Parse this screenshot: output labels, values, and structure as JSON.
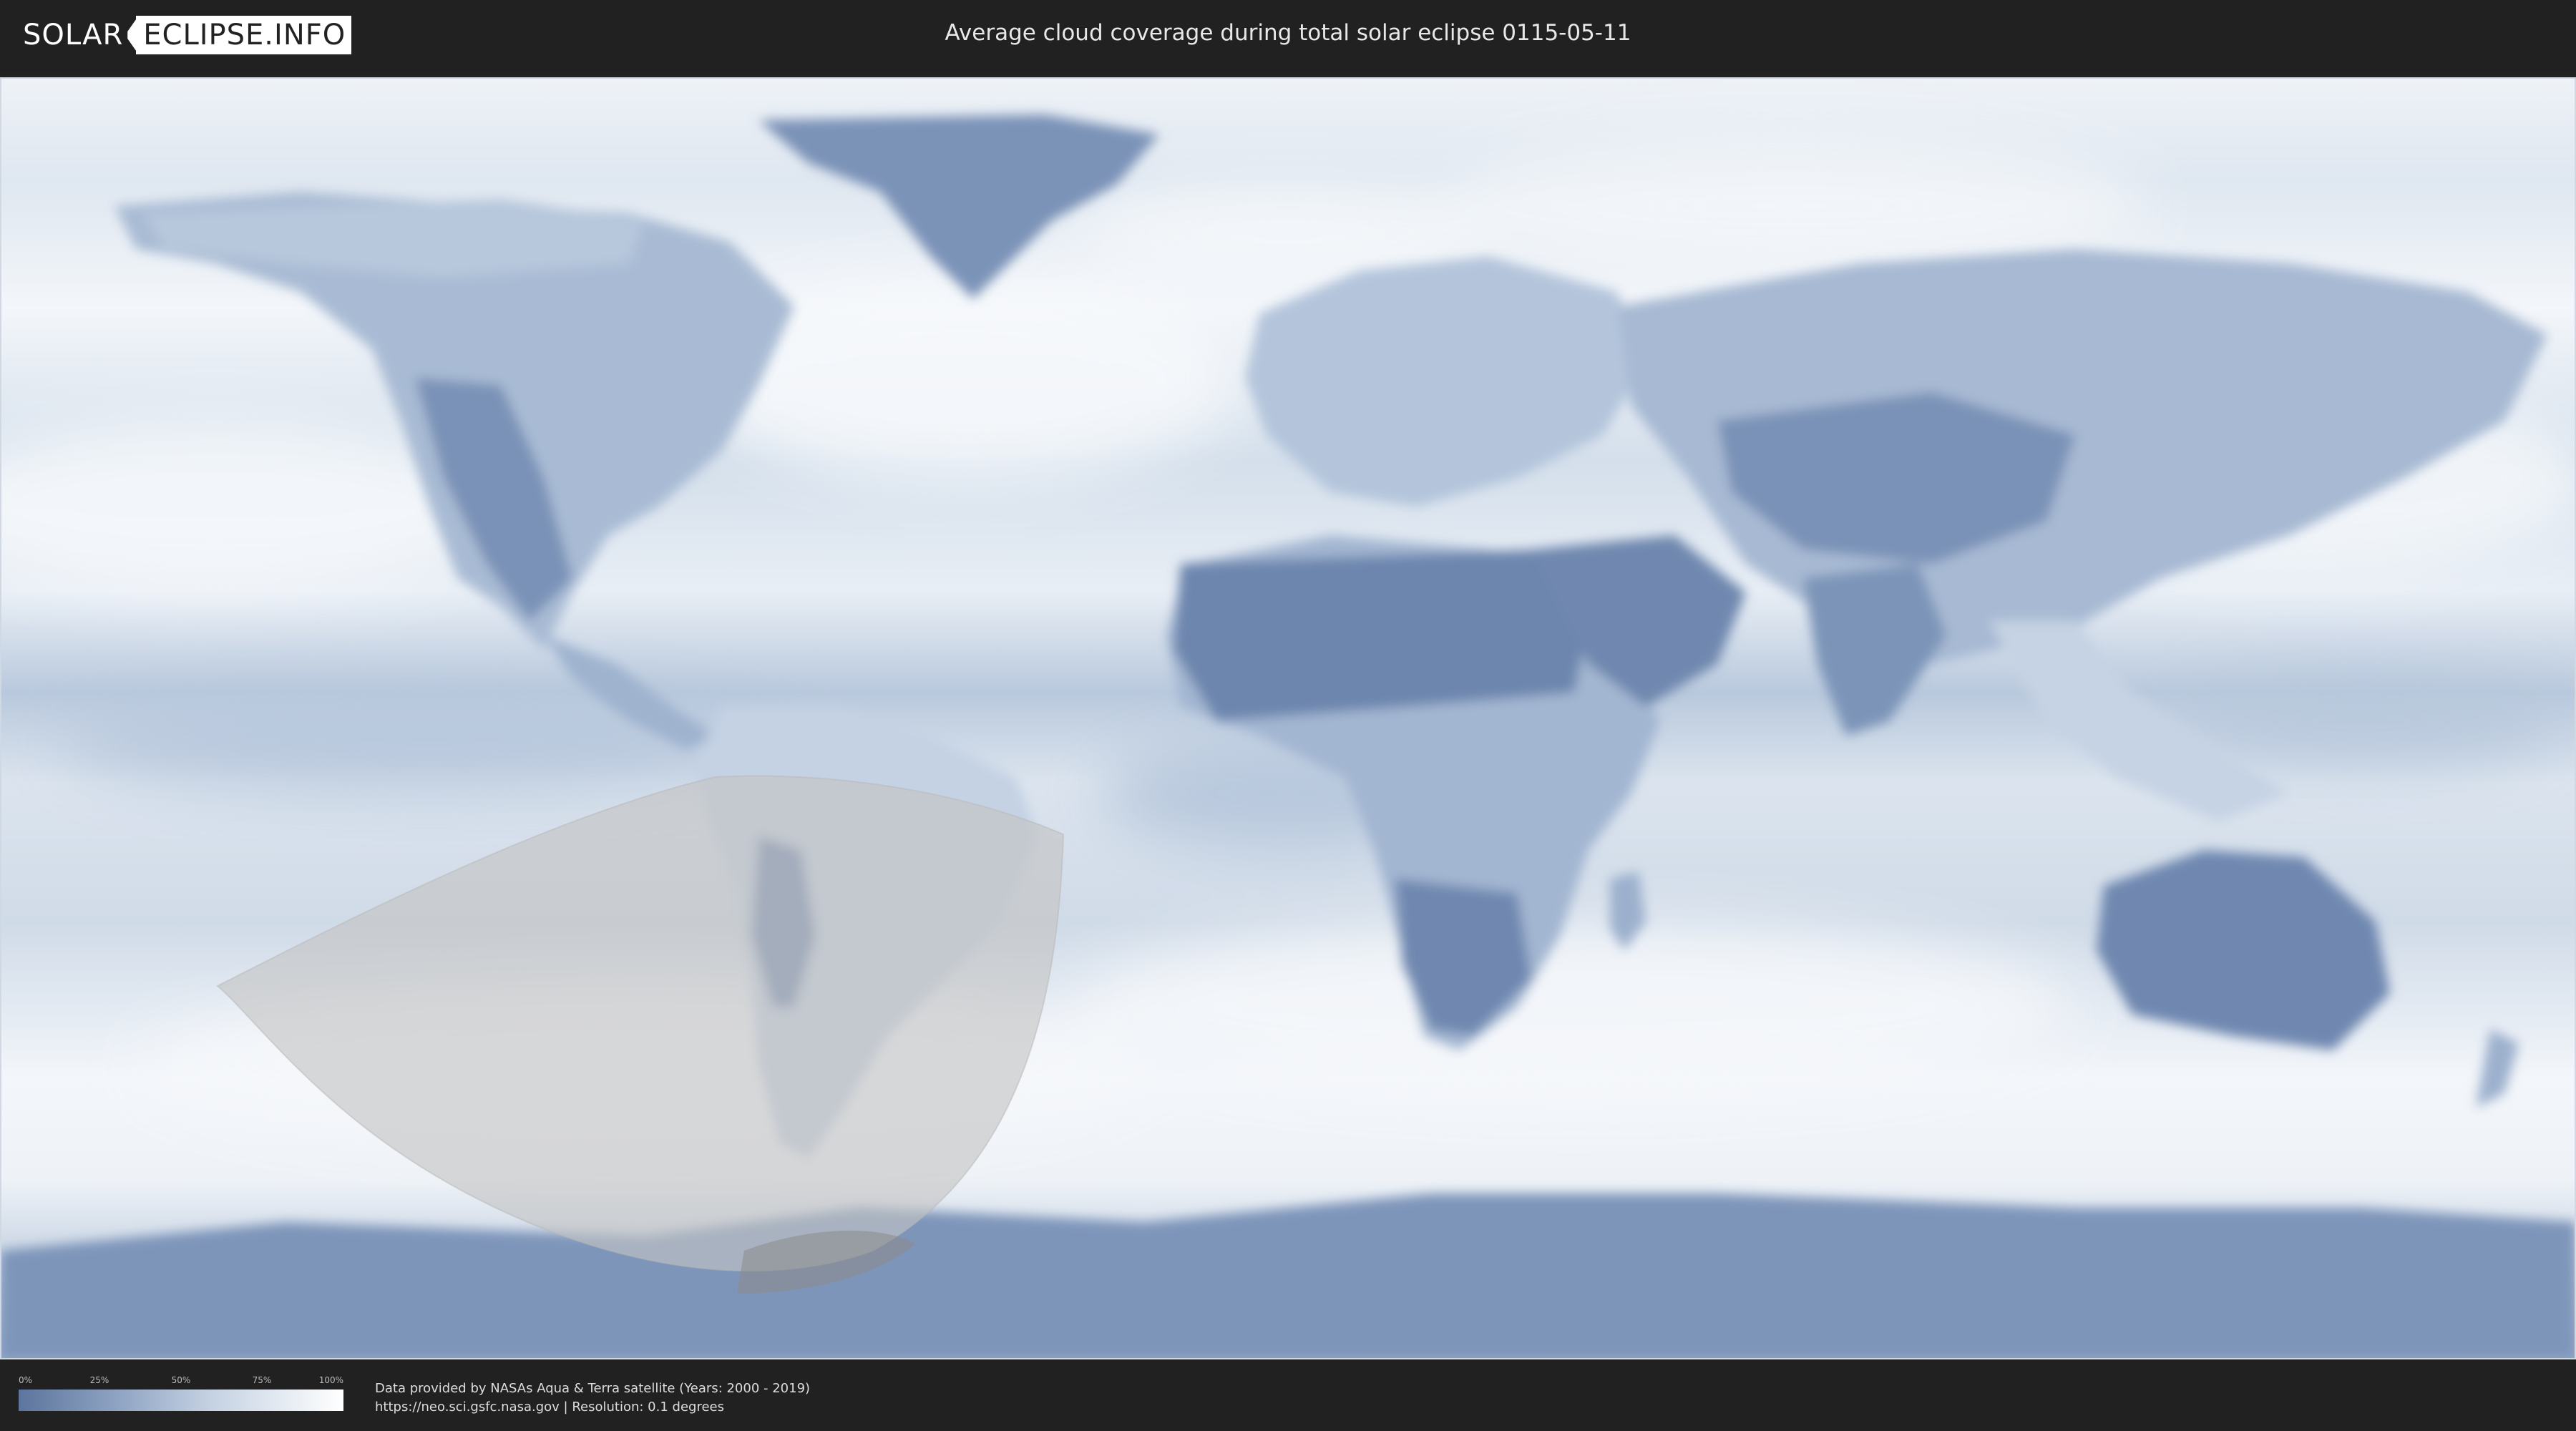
{
  "header": {
    "logo_left": "SOLAR",
    "logo_right": "ECLIPSE.INFO",
    "title": "Average cloud coverage during total solar eclipse 0115-05-11"
  },
  "legend": {
    "ticks": [
      "0%",
      "25%",
      "50%",
      "75%",
      "100%"
    ],
    "colors": {
      "low": "#5d759d",
      "mid": "#c6d3e3",
      "high": "#ffffff"
    }
  },
  "footer": {
    "line1": "Data provided by NASAs Aqua & Terra satellite (Years: 2000 - 2019)",
    "line2": "https://neo.sci.gsfc.nasa.gov | Resolution: 0.1 degrees"
  },
  "map": {
    "colors": {
      "ocean_clear": "#d9e3ee",
      "cloudy": "#f2f5f9",
      "land_clear": "#7089b0",
      "land_mid": "#a7b9d2",
      "eclipse_zone": "#c8c8c8",
      "antarctica": "#7e95ba"
    }
  }
}
